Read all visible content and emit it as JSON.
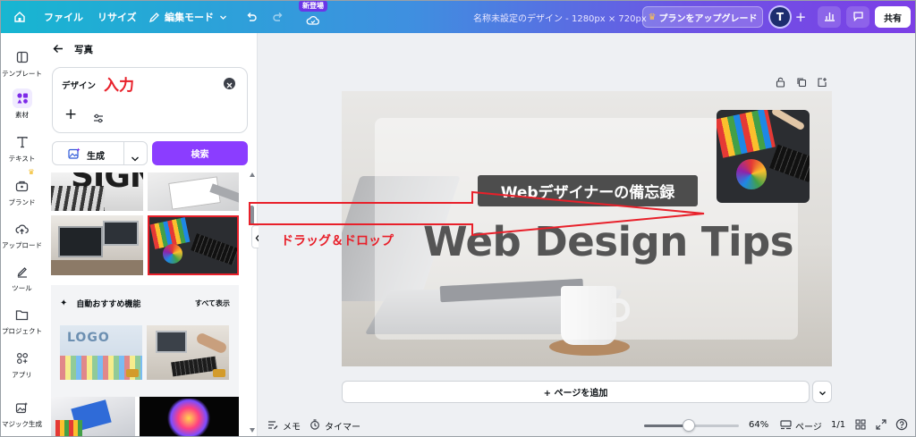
{
  "topbar": {
    "file": "ファイル",
    "resize": "リサイズ",
    "edit_mode": "編集モード",
    "new_badge": "新登場",
    "doc_title": "名称未設定のデザイン - 1280px × 720px",
    "upgrade": "プランをアップグレード",
    "avatar": "T",
    "share": "共有"
  },
  "rail": {
    "items": [
      {
        "label": "テンプレート"
      },
      {
        "label": "素材"
      },
      {
        "label": "テキスト"
      },
      {
        "label": "ブランド"
      },
      {
        "label": "アップロード"
      },
      {
        "label": "ツール"
      },
      {
        "label": "プロジェクト"
      },
      {
        "label": "アプリ"
      },
      {
        "label": "マジック生成"
      }
    ]
  },
  "panel": {
    "back_title": "写真",
    "search_value": "デザイン",
    "annotation_input": "入力",
    "generate": "生成",
    "search": "検索",
    "recommend_title": "自動おすすめ機能",
    "show_all": "すべて表示"
  },
  "canvas": {
    "annotation_drag": "ドラッグ＆ドロップ",
    "subtitle": "Webデザイナーの備忘録",
    "title": "Web Design Tips",
    "add_page": "+ ページを追加"
  },
  "bottombar": {
    "memo": "メモ",
    "timer": "タイマー",
    "zoom": "64%",
    "page": "ページ",
    "page_count": "1/1"
  },
  "colors": {
    "accent": "#8b3dff",
    "annotation_red": "#e8202a"
  }
}
